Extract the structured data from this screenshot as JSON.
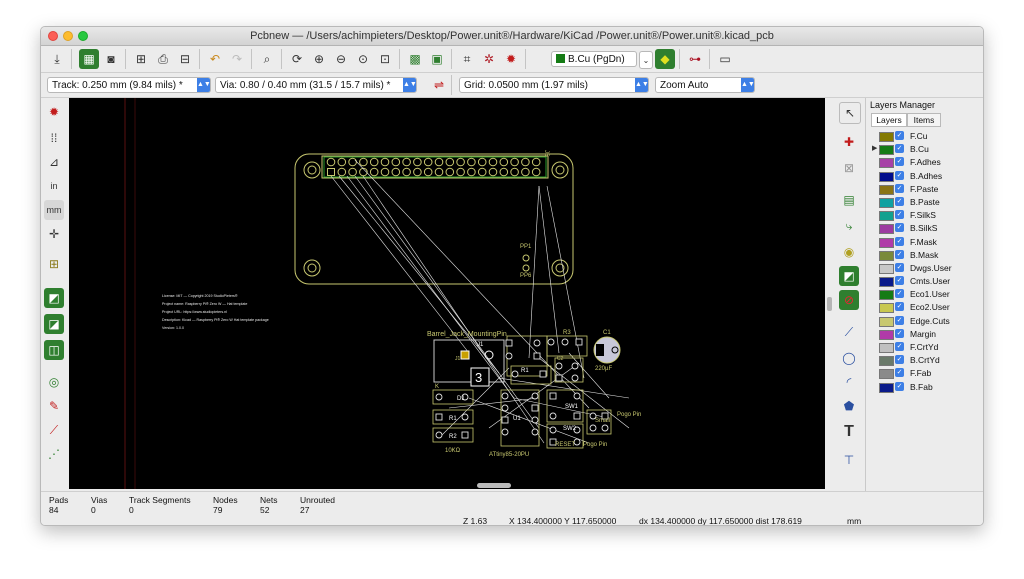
{
  "window": {
    "title": "Pcbnew — /Users/achimpieters/Desktop/Power.unit®/Hardware/KiCad /Power.unit®/Power.unit®.kicad_pcb"
  },
  "toolbar": {
    "active_layer": "B.Cu (PgDn)",
    "track": "Track: 0.250 mm (9.84 mils) *",
    "via": "Via: 0.80 / 0.40 mm (31.5 / 15.7 mils) *",
    "grid": "Grid: 0.0500 mm (1.97 mils)",
    "zoom": "Zoom Auto"
  },
  "layers_manager": {
    "title": "Layers Manager",
    "tabs": [
      "Layers",
      "Items"
    ],
    "layers": [
      {
        "name": "F.Cu",
        "color": "#847a00"
      },
      {
        "name": "B.Cu",
        "color": "#157b15"
      },
      {
        "name": "F.Adhes",
        "color": "#a63fa6"
      },
      {
        "name": "B.Adhes",
        "color": "#000c8c"
      },
      {
        "name": "F.Paste",
        "color": "#8a7415"
      },
      {
        "name": "B.Paste",
        "color": "#0fa0a0"
      },
      {
        "name": "F.SilkS",
        "color": "#11a18f"
      },
      {
        "name": "B.SilkS",
        "color": "#9c3aa0"
      },
      {
        "name": "F.Mask",
        "color": "#b03aa8"
      },
      {
        "name": "B.Mask",
        "color": "#7a8a3a"
      },
      {
        "name": "Dwgs.User",
        "color": "#c8c8c8"
      },
      {
        "name": "Cmts.User",
        "color": "#0a1a8a"
      },
      {
        "name": "Eco1.User",
        "color": "#157b15"
      },
      {
        "name": "Eco2.User",
        "color": "#c8c850"
      },
      {
        "name": "Edge.Cuts",
        "color": "#c8c870"
      },
      {
        "name": "Margin",
        "color": "#b03aa8"
      },
      {
        "name": "F.CrtYd",
        "color": "#c0c0c0"
      },
      {
        "name": "B.CrtYd",
        "color": "#6a7a6a"
      },
      {
        "name": "F.Fab",
        "color": "#8a8a8a"
      },
      {
        "name": "B.Fab",
        "color": "#0a1a8a"
      }
    ]
  },
  "pcb": {
    "labels": {
      "pp1": "PP1",
      "pp6": "PP6",
      "barrel": "Barrel_Jack_MountingPin",
      "j1": "J1",
      "j1b": "J1",
      "r3": "R3",
      "c1": "C1",
      "r1": "R1",
      "c2": "C2",
      "d1": "D1",
      "r_1": "R1",
      "r2": "R2",
      "res": "10KΩ",
      "u1": "U1",
      "sw1": "SW1",
      "sw2": "SW2",
      "reset": "RESET",
      "pogo": "Pogo Pin",
      "pogo2": "Pogo Pin",
      "cap": "220µF",
      "small": "Small",
      "mcu": "ATtiny85-20PU",
      "k": "K",
      "three": "3"
    },
    "info": [
      "License: MIT — Copyright 2019 StudioPieters®",
      "Project name: Raspberry Pi® Zero W — Hat template",
      "Project URL: https://www.studiopieters.nl",
      "Description: Kicad — Raspberry Pi® Zero W Hat template package",
      "Version: 1.0.0"
    ]
  },
  "status": {
    "pads_label": "Pads",
    "pads": "84",
    "vias_label": "Vias",
    "vias": "0",
    "tracks_label": "Track Segments",
    "tracks": "0",
    "nodes_label": "Nodes",
    "nodes": "79",
    "nets_label": "Nets",
    "nets": "52",
    "unrouted_label": "Unrouted",
    "unrouted": "27",
    "zoom": "Z 1.63",
    "xy": "X 134.400000  Y 117.650000",
    "dxdy": "dx 134.400000  dy 117.650000  dist 178.619",
    "units": "mm"
  }
}
